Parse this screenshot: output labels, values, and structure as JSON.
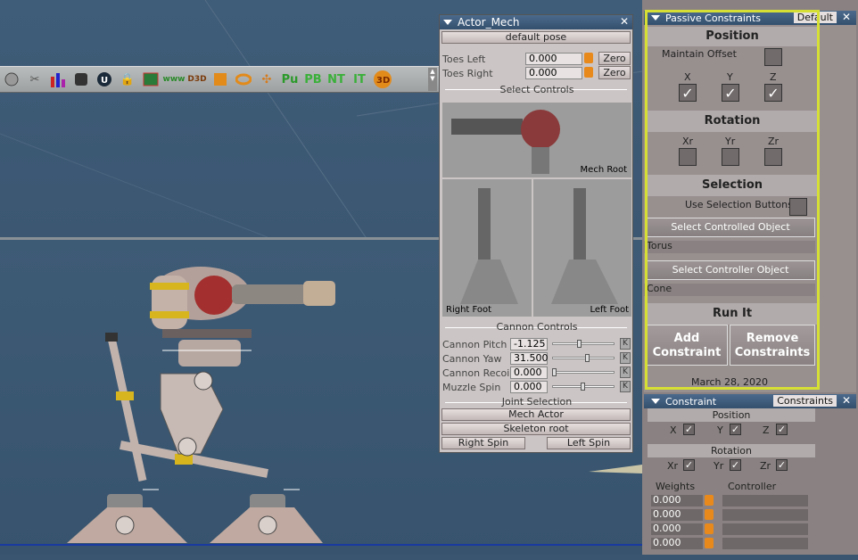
{
  "toolbar": {
    "icons": [
      "sphere-icon",
      "scissors-icon",
      "bar-chart-icon",
      "box-icon",
      "unreal-icon",
      "lock-icon",
      "photo-icon"
    ],
    "www_label": "www",
    "d3d_label": "D3D",
    "pu_label": "Pu",
    "pb_label": "PB",
    "nt_label": "NT",
    "it_label": "IT",
    "threed_label": "3D"
  },
  "actor_panel": {
    "title": "Actor_Mech",
    "default_pose": "default pose",
    "toes_left_label": "Toes Left",
    "toes_left_value": "0.000",
    "toes_right_label": "Toes Right",
    "toes_right_value": "0.000",
    "zero_label": "Zero",
    "select_controls": "Select Controls",
    "mech_root": "Mech Root",
    "right_foot": "Right Foot",
    "left_foot": "Left Foot",
    "cannon_controls": "Cannon Controls",
    "cannon_pitch_label": "Cannon Pitch",
    "cannon_pitch_value": "-1.125",
    "cannon_yaw_label": "Cannon Yaw",
    "cannon_yaw_value": "31.500",
    "cannon_recoil_label": "Cannon Recoil",
    "cannon_recoil_value": "0.000",
    "muzzle_spin_label": "Muzzle Spin",
    "muzzle_spin_value": "0.000",
    "k_label": "K",
    "joint_selection": "Joint Selection",
    "mech_actor": "Mech Actor",
    "skeleton_root": "Skeleton root",
    "right_spin": "Right Spin",
    "left_spin": "Left Spin"
  },
  "passive_panel": {
    "title": "Passive Constraints",
    "preset": "Default",
    "position_head": "Position",
    "maintain_offset": "Maintain Offset",
    "x": "X",
    "y": "Y",
    "z": "Z",
    "rotation_head": "Rotation",
    "xr": "Xr",
    "yr": "Yr",
    "zr": "Zr",
    "selection_head": "Selection",
    "use_selection_buttons": "Use Selection Buttons",
    "select_controlled": "Select Controlled Object",
    "controlled_value": "Torus",
    "select_controller": "Select Controller Object",
    "controller_value": "Cone",
    "run_it_head": "Run It",
    "add_constraint": "Add Constraint",
    "remove_constraints": "Remove Constraints",
    "date": "March 28, 2020",
    "checks": {
      "x": true,
      "y": true,
      "z": true,
      "maintain_offset": false,
      "xr": false,
      "yr": false,
      "zr": false,
      "use_selection": false
    }
  },
  "constraint_panel": {
    "title": "Constraint",
    "tab": "Constraints",
    "position_head": "Position",
    "x": "X",
    "y": "Y",
    "z": "Z",
    "rotation_head": "Rotation",
    "xr": "Xr",
    "yr": "Yr",
    "zr": "Zr",
    "weights_head": "Weights",
    "controller_head": "Controller",
    "weights": [
      "0.000",
      "0.000",
      "0.000",
      "0.000"
    ]
  },
  "colors": {
    "highlight": "#d6e034",
    "title_bar": "#3e5c7c",
    "viewport": "#3d5a75"
  }
}
